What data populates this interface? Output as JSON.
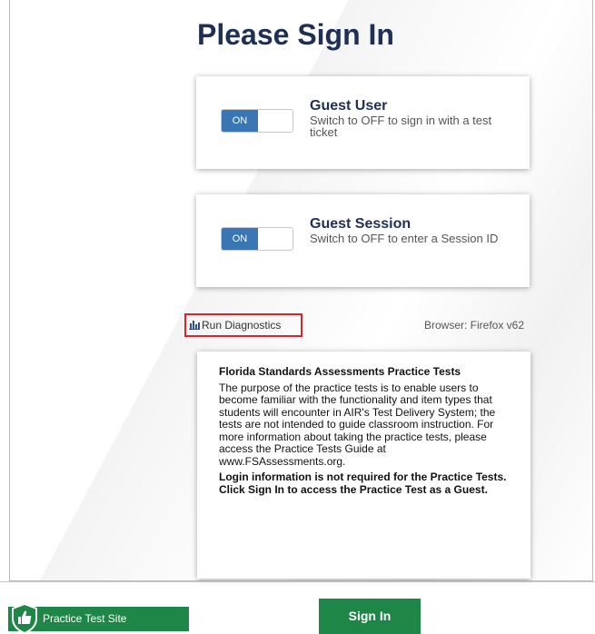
{
  "page": {
    "title": "Please Sign In"
  },
  "guest_user": {
    "toggle_label": "ON",
    "title": "Guest User",
    "description": "Switch to OFF to sign in with a test ticket"
  },
  "guest_session": {
    "toggle_label": "ON",
    "title": "Guest Session",
    "description": "Switch to OFF to enter a Session ID"
  },
  "diagnostics": {
    "label": "Run Diagnostics",
    "icon": "bar-chart-icon"
  },
  "browser": {
    "text": "Browser: Firefox v62"
  },
  "info": {
    "heading": "Florida Standards Assessments Practice Tests",
    "body": "The purpose of the practice tests is to enable users to become familiar with the functionality and item types that students will encounter in AIR's Test Delivery System; the tests are not intended to guide classroom instruction. For more information about taking the practice tests, please access the Practice Tests Guide at www.FSAssessments.org.",
    "note": "Login information is not required for the Practice Tests. Click Sign In to access the Practice Test as a Guest."
  },
  "footer": {
    "practice_label": "Practice Test Site",
    "practice_icon": "shield-thumbs-up-icon",
    "sign_in_label": "Sign In"
  },
  "colors": {
    "title": "#1f2f55",
    "toggle_on": "#3a76b3",
    "footer_green": "#1e8646",
    "highlight_red": "#d9262c"
  }
}
